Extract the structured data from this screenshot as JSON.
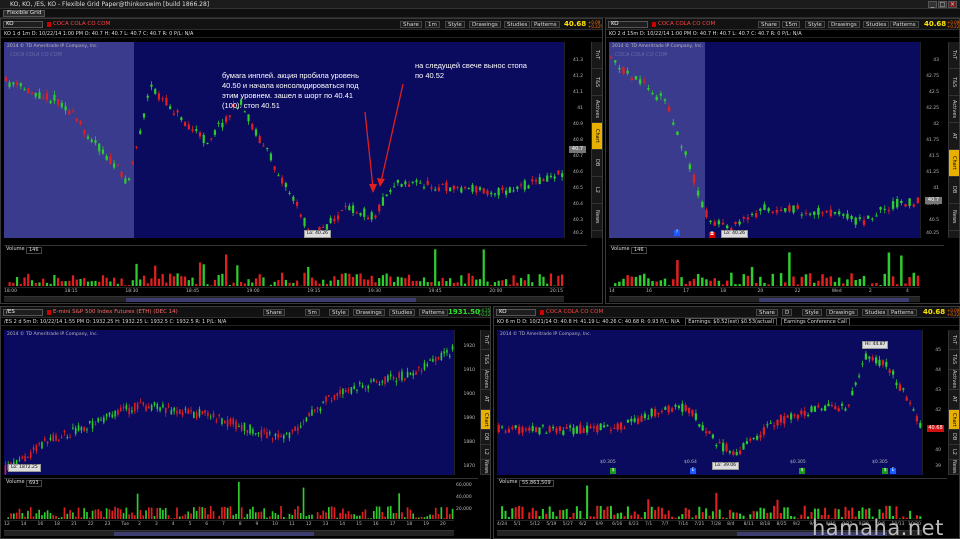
{
  "window": {
    "title": "KO, KO, /ES, KO - Flexible Grid Paper@thinkorswim [build 1866.28]",
    "grid_button": "Flexible Grid"
  },
  "common": {
    "company": "COCA COLA CO COM",
    "share": "Share",
    "style": "Style",
    "drawings": "Drawings",
    "studies": "Studies",
    "patterns": "Patterns",
    "copyright": "2014 © TD Ameritrade IP Company, Inc.",
    "volume_label": "Volume",
    "side_tabs": [
      "TnT",
      "T&S",
      "Actives",
      "AT",
      "Chart",
      "DB",
      "L2",
      "News"
    ]
  },
  "panels": {
    "top_left": {
      "symbol": "KO",
      "interval": "1m",
      "price": "40.68",
      "change": "+0.09 +0.22%",
      "info": "KO 1 d 1m   D: 10/22/14 1:00 PM  O: 40.7  H: 40.7  L: 40.7  C: 40.7  R: 0  P/L: N/A",
      "y_ticks": [
        "41.3",
        "41.2",
        "41.1",
        "41",
        "40.9",
        "40.8",
        "40.7",
        "40.6",
        "40.5",
        "40.4",
        "40.3",
        "40.2"
      ],
      "last_tag": "40.7",
      "low_label": "Lo: 40.26",
      "volume_value": "146",
      "vol_ticks": [
        "4",
        "3",
        "2",
        "1.5",
        "1"
      ],
      "x_ticks": [
        "18:00",
        "18:15",
        "18:30",
        "18:45",
        "19:00",
        "19:15",
        "19:30",
        "19:45",
        "20:00",
        "20:15"
      ]
    },
    "top_right": {
      "symbol": "KO",
      "interval": "15m",
      "price": "40.68",
      "change": "+0.09 +0.22%",
      "info": "KO 2 d 15m   D: 10/22/14 1:00 PM  O: 40.7  H: 40.7  L: 40.7  C: 40.7  R: 0  P/L: N/A",
      "y_ticks": [
        "43",
        "42.75",
        "42.5",
        "42.25",
        "42",
        "41.75",
        "41.5",
        "41.25",
        "41",
        "40.75",
        "40.5",
        "40.25"
      ],
      "last_tag": "40.7",
      "low_label": "Lo: 40.26",
      "volume_value": "146",
      "vol_ticks": [
        "10",
        "8",
        "6",
        "4",
        "2"
      ],
      "x_ticks": [
        "14",
        "16",
        "17",
        "18",
        "20",
        "22",
        "Wed",
        "2",
        "4"
      ]
    },
    "bottom_left": {
      "symbol": "/ES",
      "interval": "5m",
      "price": "1931.50",
      "change": "+4.25 +0.22%",
      "company": "E-mini S&P 500 Index Futures (ETH) (DEC 14)",
      "info": "/ES 2 d 5m   D: 10/22/14 1:55 PM  O: 1932.25  H: 1932.25  L: 1932.5  C: 1932.5  R: 1  P/L: N/A",
      "y_ticks": [
        "1920",
        "1910",
        "1900",
        "1890",
        "1880",
        "1870"
      ],
      "low_label": "Lo: 1872.25",
      "volume_value": "693",
      "vol_ticks": [
        "60,000",
        "40,000",
        "20,000"
      ],
      "x_ticks": [
        "12",
        "14",
        "16",
        "18",
        "21",
        "22",
        "23",
        "Tue",
        "2",
        "3",
        "4",
        "5",
        "6",
        "7",
        "8",
        "9",
        "10",
        "11",
        "12",
        "13",
        "14",
        "15",
        "16",
        "17",
        "18",
        "19",
        "20"
      ]
    },
    "bottom_right": {
      "symbol": "KO",
      "interval": "D",
      "price": "40.68",
      "change": "+0.09 +0.22%",
      "info": "KO 6 m D   D: 10/21/14  O: 40.8  H: 41.19  L: 40.26  C: 40.68  R: 0.93  P/L: N/A",
      "extra_info": [
        "Earnings: $0.52(est) $0.53(actual)",
        "Earnings Conference Call"
      ],
      "y_ticks": [
        "45",
        "44",
        "43",
        "42",
        "41",
        "40",
        "39"
      ],
      "last_tag": "40.68",
      "hi_label": "Hi: 44.87",
      "low_label": "Lo: 39.06",
      "volume_value": "55,863,509",
      "vol_ticks": [
        "40",
        "30",
        "20"
      ],
      "x_ticks": [
        "4/24",
        "5/1",
        "5/12",
        "5/19",
        "5/27",
        "6/2",
        "6/9",
        "6/16",
        "6/23",
        "7/1",
        "7/7",
        "7/14",
        "7/21",
        "7/28",
        "8/4",
        "8/11",
        "8/18",
        "8/25",
        "9/2",
        "9/8",
        "9/15",
        "9/22",
        "9/29",
        "10/6",
        "10/13",
        "10/20"
      ],
      "events": [
        {
          "label": "$0.305"
        },
        {
          "label": "$0.64"
        },
        {
          "label": "$0.305"
        },
        {
          "label": "$0.305"
        }
      ]
    }
  },
  "annotations": {
    "left": "бумага инплей.  акция пробила уровень 40.50 и начала консолидироваться под этим уровнем. зашел в шорт по 40.41 (100). стоп 40.51",
    "right": "на следущей свече вынос стопа по 40.52"
  },
  "watermark": "hamaha.net",
  "colors": {
    "plot_bg": "#0a0a5e",
    "up_candle": "#2ecc2e",
    "down_candle": "#e02020",
    "price": "#ffe400",
    "active_tab": "#e8b000"
  }
}
